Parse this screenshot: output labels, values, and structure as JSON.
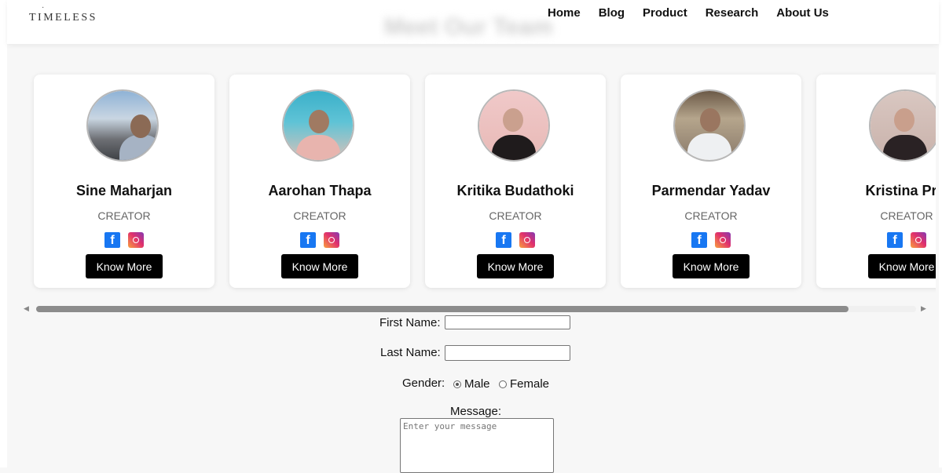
{
  "header": {
    "logo_text": "TIMELESS",
    "logo_mark": "· ·",
    "section_title": "Meet Our Team",
    "nav": [
      "Home",
      "Blog",
      "Product",
      "Research",
      "About Us"
    ]
  },
  "team": [
    {
      "name": "Sine Maharjan",
      "role": "CREATOR",
      "button": "Know More"
    },
    {
      "name": "Aarohan Thapa",
      "role": "CREATOR",
      "button": "Know More"
    },
    {
      "name": "Kritika Budathoki",
      "role": "CREATOR",
      "button": "Know More"
    },
    {
      "name": "Parmendar Yadav",
      "role": "CREATOR",
      "button": "Know More"
    },
    {
      "name": "Kristina Pr...",
      "role": "CREATOR",
      "button": "Know More"
    }
  ],
  "social_icons": [
    "facebook-icon",
    "instagram-icon"
  ],
  "form": {
    "first_name_label": "First Name:",
    "first_name_value": "",
    "last_name_label": "Last Name:",
    "last_name_value": "",
    "gender_label": "Gender:",
    "gender_options": [
      "Male",
      "Female"
    ],
    "gender_selected": "Male",
    "message_label": "Message:",
    "message_placeholder": "Enter your message"
  },
  "colors": {
    "button_bg": "#000000",
    "facebook": "#1877f2",
    "scroll_thumb": "#8c8c8c"
  }
}
